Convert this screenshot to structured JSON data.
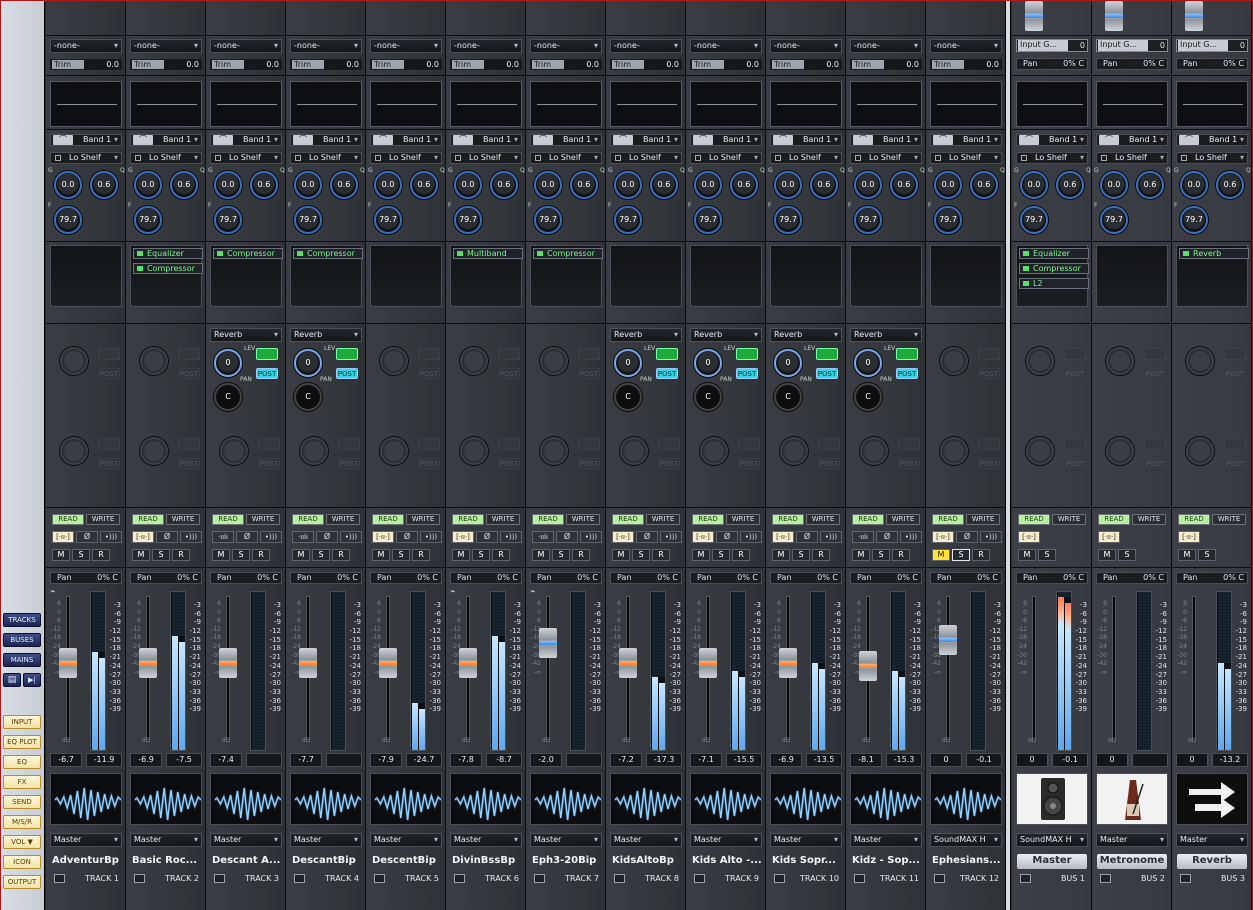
{
  "sidebar": {
    "blue": [
      "TRACKS",
      "BUSES",
      "MAINS"
    ],
    "cream": [
      "INPUT",
      "EQ PLOT",
      "EQ",
      "FX",
      "SEND",
      "M/S/R",
      "VOL ▼",
      "ICON",
      "OUTPUT"
    ],
    "icons": [
      "window-icon",
      "play-icon"
    ]
  },
  "labels": {
    "trim": "Trim",
    "input_gain": "Input G...",
    "band": "Band 1",
    "shelf": "Lo Shelf",
    "gain": "0.0",
    "q": "0.6",
    "freq": "79.7",
    "read": "READ",
    "write": "WRITE",
    "m": "M",
    "s": "S",
    "r": "R",
    "pan": "Pan",
    "lev": "LEV",
    "pan_small": "PAN",
    "post": "POST",
    "c": "C",
    "db": "dB",
    "g": "G",
    "q_tag": "Q",
    "f_tag": "F"
  },
  "meter_scale": [
    "-3",
    "-6",
    "-9",
    "-12",
    "-15",
    "-18",
    "-21",
    "-24",
    "-27",
    "-30",
    "-33",
    "-36",
    "-39"
  ],
  "fader_scale": [
    "6",
    "0",
    "-6",
    "-12",
    "-18",
    "-24",
    "-30",
    "-42",
    "-∞"
  ],
  "tracks": [
    {
      "input": "-none-",
      "trim": "0.0",
      "fx": [],
      "send": "",
      "pan": "0% C",
      "vol": "-6.7",
      "peak": "-11.9",
      "output": "Master",
      "name": "AdventurBp",
      "num": "TRACK 1",
      "level": 0.62,
      "fader": 0.55,
      "armed": false,
      "phase": false,
      "auto": true
    },
    {
      "input": "-none-",
      "trim": "0.0",
      "fx": [
        "Equalizer",
        "Compressor"
      ],
      "send": "",
      "pan": "0% C",
      "vol": "-6.9",
      "peak": "-7.5",
      "output": "Master",
      "name": "Basic Roc...",
      "num": "TRACK 2",
      "level": 0.72,
      "fader": 0.55,
      "armed": false,
      "phase": false,
      "auto": false
    },
    {
      "input": "-none-",
      "trim": "0.0",
      "fx": [
        "Compressor"
      ],
      "send": "Reverb",
      "pan": "0% C",
      "vol": "-7.4",
      "peak": "",
      "output": "Master",
      "name": "Descant A...",
      "num": "TRACK 3",
      "level": 0,
      "fader": 0.55,
      "armed": true,
      "phase": true,
      "auto": false
    },
    {
      "input": "-none-",
      "trim": "0.0",
      "fx": [
        "Compressor"
      ],
      "send": "Reverb",
      "pan": "0% C",
      "vol": "-7.7",
      "peak": "",
      "output": "Master",
      "name": "DescantBip",
      "num": "TRACK 4",
      "level": 0,
      "fader": 0.55,
      "armed": true,
      "phase": false,
      "auto": false
    },
    {
      "input": "-none-",
      "trim": "0.0",
      "fx": [],
      "send": "",
      "pan": "0% C",
      "vol": "-7.9",
      "peak": "-24.7",
      "output": "Master",
      "name": "DescentBip",
      "num": "TRACK 5",
      "level": 0.3,
      "fader": 0.55,
      "armed": false,
      "phase": false,
      "auto": false
    },
    {
      "input": "-none-",
      "trim": "0.0",
      "fx": [
        "Multiband"
      ],
      "send": "",
      "pan": "0% C",
      "vol": "-7.8",
      "peak": "-8.7",
      "output": "Master",
      "name": "DivinBssBp",
      "num": "TRACK 6",
      "level": 0.72,
      "fader": 0.55,
      "armed": false,
      "phase": false,
      "auto": true
    },
    {
      "input": "-none-",
      "trim": "0.0",
      "fx": [
        "Compressor"
      ],
      "send": "",
      "pan": "0% C",
      "vol": "-2.0",
      "peak": "",
      "output": "Master",
      "name": "Eph3-20Bip",
      "num": "TRACK 7",
      "level": 0,
      "fader": 0.72,
      "armed": true,
      "phase": true,
      "auto": true
    },
    {
      "input": "-none-",
      "trim": "0.0",
      "fx": [],
      "send": "Reverb",
      "pan": "0% C",
      "vol": "-7.2",
      "peak": "-17.3",
      "output": "Master",
      "name": "KidsAltoBp",
      "num": "TRACK 8",
      "level": 0.46,
      "fader": 0.55,
      "armed": false,
      "phase": false,
      "auto": false
    },
    {
      "input": "-none-",
      "trim": "0.0",
      "fx": [],
      "send": "Reverb",
      "pan": "0% C",
      "vol": "-7.1",
      "peak": "-15.5",
      "output": "Master",
      "name": "Kids Alto -...",
      "num": "TRACK 9",
      "level": 0.5,
      "fader": 0.55,
      "armed": false,
      "phase": false,
      "auto": false
    },
    {
      "input": "-none-",
      "trim": "0.0",
      "fx": [],
      "send": "Reverb",
      "pan": "0% C",
      "vol": "-6.9",
      "peak": "-13.5",
      "output": "Master",
      "name": "Kids Sopr...",
      "num": "TRACK 10",
      "level": 0.55,
      "fader": 0.55,
      "armed": false,
      "phase": false,
      "auto": false
    },
    {
      "input": "-none-",
      "trim": "0.0",
      "fx": [],
      "send": "Reverb",
      "pan": "0% C",
      "vol": "-8.1",
      "peak": "-15.3",
      "output": "Master",
      "name": "Kidz - Sop...",
      "num": "TRACK 11",
      "level": 0.5,
      "fader": 0.53,
      "armed": true,
      "phase": false,
      "auto": false
    },
    {
      "input": "-none-",
      "trim": "0.0",
      "fx": [],
      "send": "",
      "pan": "0% C",
      "vol": "0",
      "peak": "-0.1",
      "output": "SoundMAX H",
      "name": "Ephesians...",
      "num": "TRACK 12",
      "level": 0,
      "fader": 0.75,
      "armed": false,
      "phase": false,
      "auto": false,
      "mute": true
    }
  ],
  "buses": [
    {
      "gain": "0",
      "pan": "0% C",
      "fx": [
        "Equalizer",
        "Compressor",
        "L2"
      ],
      "vol": "0",
      "peak": "-0.1",
      "output": "SoundMAX H",
      "name": "Master",
      "num": "BUS 1",
      "level": 0.97,
      "icon": "speaker-icon"
    },
    {
      "gain": "0",
      "pan": "0% C",
      "fx": [],
      "vol": "0",
      "peak": "",
      "output": "Master",
      "name": "Metronome",
      "num": "BUS 2",
      "level": 0,
      "icon": "metronome-icon"
    },
    {
      "gain": "0",
      "pan": "0% C",
      "fx": [
        "Reverb"
      ],
      "vol": "0",
      "peak": "-13.2",
      "output": "Master",
      "name": "Reverb",
      "num": "BUS 3",
      "level": 0.55,
      "icon": "arrows-icon"
    }
  ],
  "colors": {
    "accent_blue": "#3a6fc0",
    "fx_green": "#57e06a",
    "read_green": "#b8f0a0",
    "post_cyan": "#33d6e6",
    "mute_yellow": "#ffe23a"
  }
}
